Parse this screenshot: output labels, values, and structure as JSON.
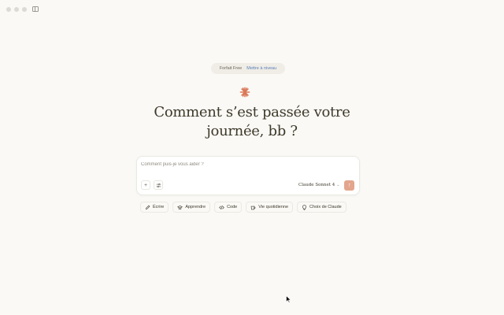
{
  "plan": {
    "name": "Forfait Free",
    "upgrade": "Mettre à niveau"
  },
  "greeting": {
    "line1": "Comment s’est passée votre",
    "line2": "journée, bb ?"
  },
  "composer": {
    "placeholder": "Comment puis-je vous aider ?",
    "model": "Claude Sonnet 4"
  },
  "chips": [
    {
      "label": "Écrire",
      "icon": "pencil-icon"
    },
    {
      "label": "Apprendre",
      "icon": "graduation-cap-icon"
    },
    {
      "label": "Code",
      "icon": "code-icon"
    },
    {
      "label": "Vie quotidienne",
      "icon": "coffee-cup-icon"
    },
    {
      "label": "Choix de Claude",
      "icon": "lightbulb-icon"
    }
  ],
  "colors": {
    "accent": "#d97757",
    "send_button": "#e3a58e",
    "background": "#faf9f6"
  }
}
